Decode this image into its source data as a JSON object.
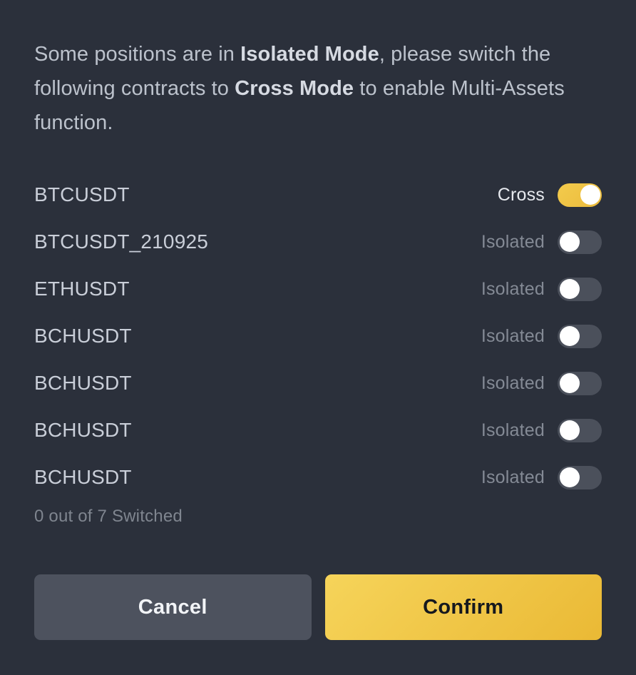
{
  "dialog": {
    "message": {
      "part1": "Some positions are in ",
      "bold1": "Isolated Mode",
      "part2": ", please switch the following contracts to ",
      "bold2": "Cross Mode",
      "part3": " to enable Multi-Assets function."
    },
    "contracts": [
      {
        "name": "BTCUSDT",
        "mode": "Cross",
        "enabled": true
      },
      {
        "name": "BTCUSDT_210925",
        "mode": "Isolated",
        "enabled": false
      },
      {
        "name": "ETHUSDT",
        "mode": "Isolated",
        "enabled": false
      },
      {
        "name": "BCHUSDT",
        "mode": "Isolated",
        "enabled": false
      },
      {
        "name": "BCHUSDT",
        "mode": "Isolated",
        "enabled": false
      },
      {
        "name": "BCHUSDT",
        "mode": "Isolated",
        "enabled": false
      },
      {
        "name": "BCHUSDT",
        "mode": "Isolated",
        "enabled": false
      }
    ],
    "switched_count_text": "0 out of 7 Switched",
    "buttons": {
      "cancel": "Cancel",
      "confirm": "Confirm"
    },
    "colors": {
      "background": "#2b303b",
      "accent": "#ebbb3d",
      "toggle_off_track": "#4b505b",
      "toggle_knob": "#ffffff",
      "cancel_button": "#4d525e",
      "contract_text": "#c9ced8",
      "muted_text": "#848a95"
    }
  }
}
